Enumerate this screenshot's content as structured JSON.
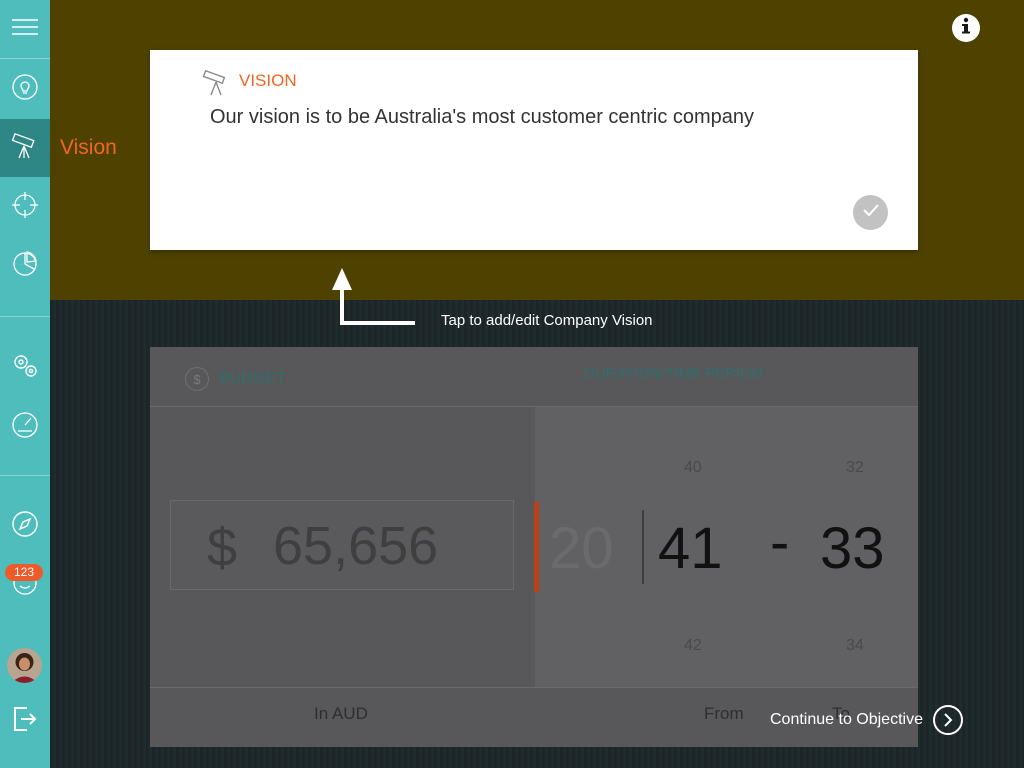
{
  "colors": {
    "sidebar": "#4fbdbc",
    "sidebar_active": "#2e8784",
    "accent": "#f26522",
    "top_band": "#4f4200"
  },
  "sidebar": {
    "items": [
      {
        "icon": "menu-icon"
      },
      {
        "icon": "lightbulb-icon"
      },
      {
        "icon": "telescope-icon",
        "active": true
      },
      {
        "icon": "target-icon"
      },
      {
        "icon": "pie-chart-icon"
      },
      {
        "icon": "gears-icon"
      },
      {
        "icon": "speedometer-icon"
      },
      {
        "icon": "compass-icon"
      },
      {
        "icon": "smiley-icon"
      },
      {
        "icon": "avatar"
      },
      {
        "icon": "exit-icon"
      }
    ],
    "badge": "123"
  },
  "page": {
    "side_label": "Vision"
  },
  "vision_card": {
    "title": "VISION",
    "text": "Our vision is to be Australia's most customer centric company"
  },
  "hint": {
    "text": "Tap to add/edit Company Vision"
  },
  "budget_card": {
    "budget_title": "BUDGET",
    "duration_title": "DURATION/TIME PERIOD",
    "currency": "$",
    "amount": "65,656",
    "amount_label": "In AUD",
    "picker": {
      "prefix_faint": "20",
      "from_above": "40",
      "from_value": "41",
      "from_below": "42",
      "separator": "-",
      "to_above": "32",
      "to_value": "33",
      "to_below": "34"
    },
    "from_label": "From",
    "to_label": "To"
  },
  "continue": {
    "label": "Continue to Objective"
  }
}
